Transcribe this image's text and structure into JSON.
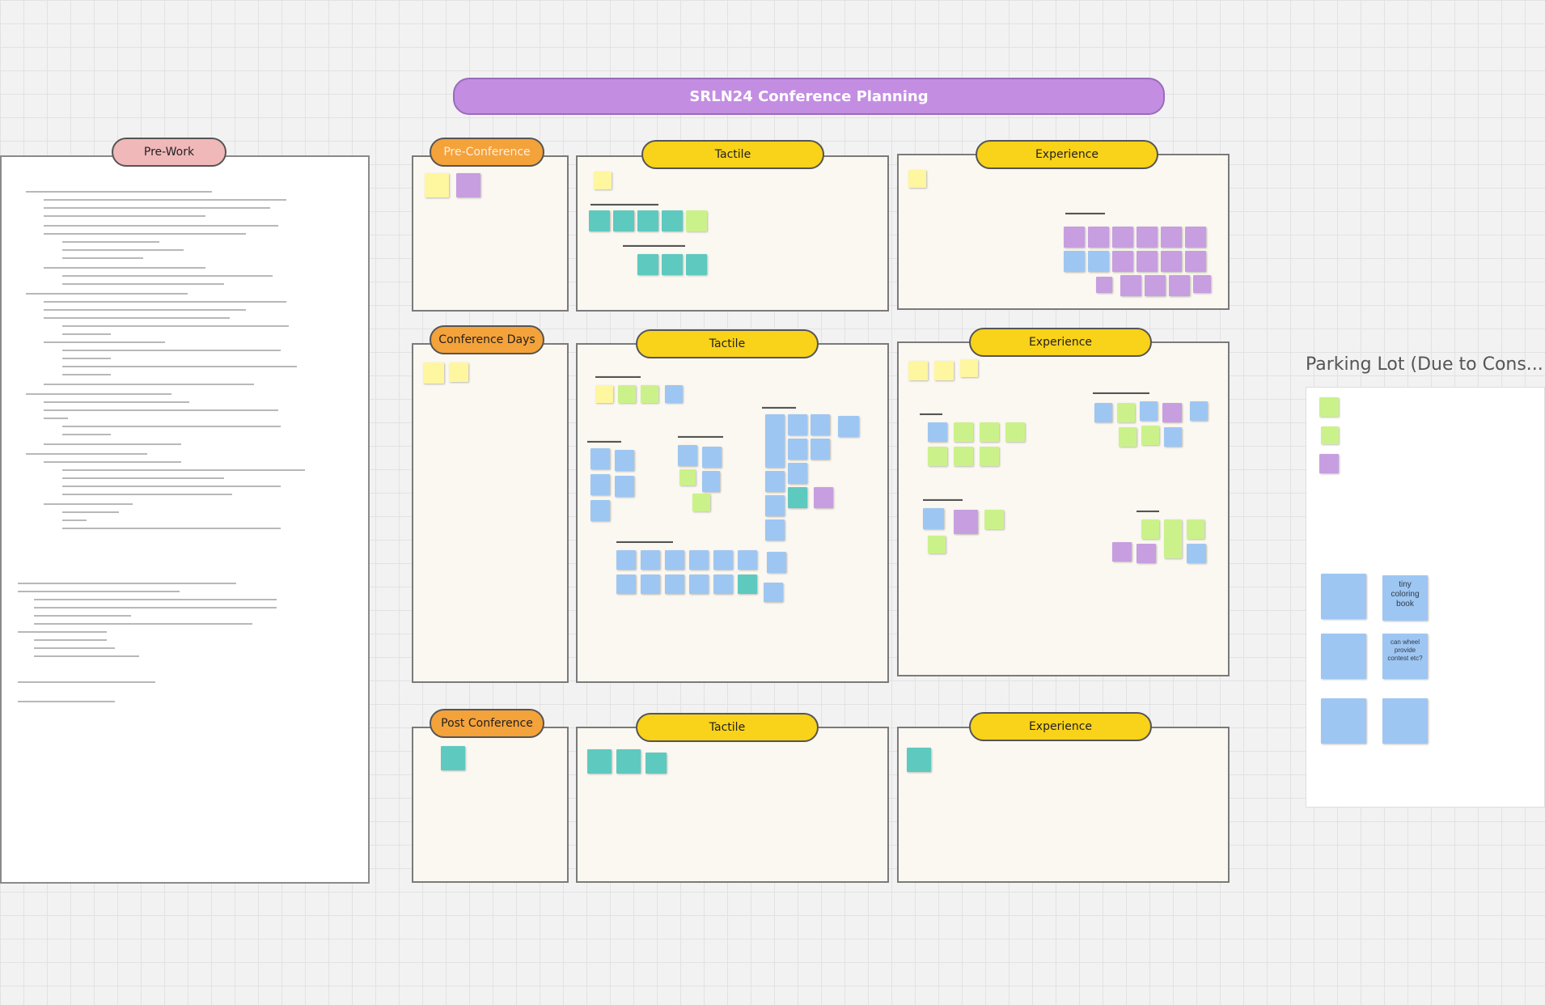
{
  "board": {
    "title": "SRLN24 Conference Planning",
    "colors": {
      "title_pill": "#c38ee2",
      "section_pill": "#f4a23a",
      "category_pill": "#f9d21a",
      "prework_pill": "#f0b8b9",
      "frame_fill": "#fbf8f1"
    }
  },
  "prework": {
    "label": "Pre-Work"
  },
  "sections": {
    "pre_conference": "Pre-Conference",
    "conference_days": "Conference Days",
    "post_conference": "Post Conference"
  },
  "categories": {
    "tactile": "Tactile",
    "experience": "Experience"
  },
  "parking_lot": {
    "title": "Parking Lot (Due to Cons...",
    "notes": [
      "tiny coloring book",
      "can wheel provide contest etc?"
    ]
  }
}
